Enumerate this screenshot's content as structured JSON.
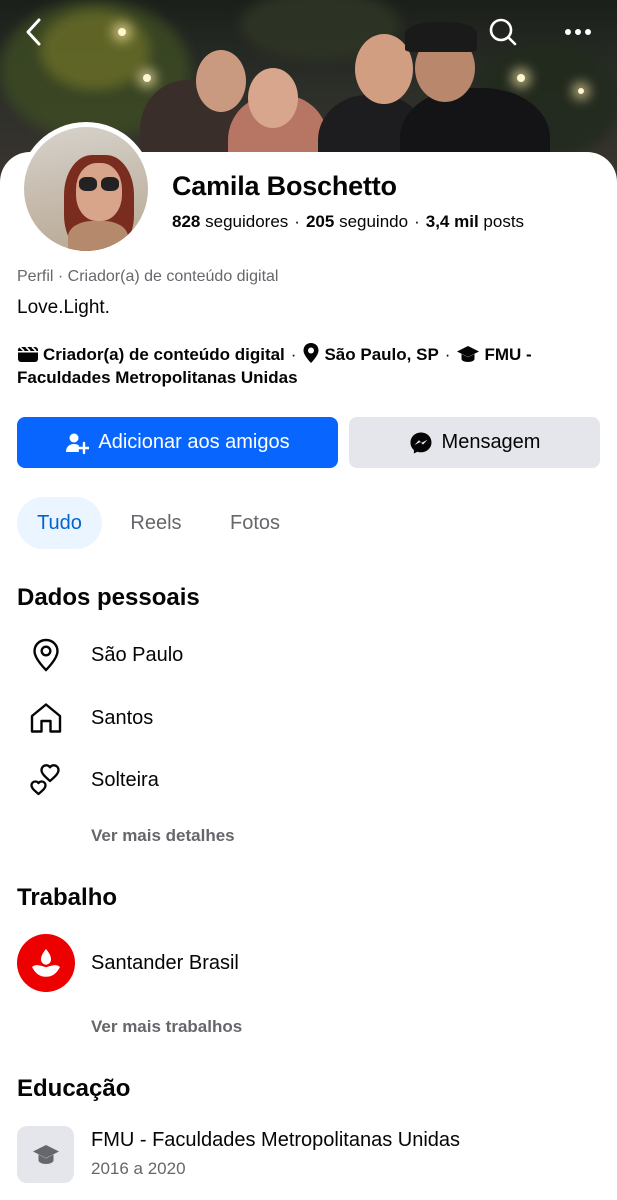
{
  "profile": {
    "name": "Camila Boschetto",
    "followers_count": "828",
    "followers_label": "seguidores",
    "following_count": "205",
    "following_label": "seguindo",
    "posts_count": "3,4 mil",
    "posts_label": "posts",
    "subtitle": "Perfil · Criador(a) de conteúdo digital",
    "bio": "Love.Light."
  },
  "intro": {
    "category": "Criador(a) de conteúdo digital",
    "location": "São Paulo, SP",
    "education": "FMU - Faculdades Metropolitanas Unidas",
    "separator": "·"
  },
  "actions": {
    "add_friend": "Adicionar aos amigos",
    "message": "Mensagem"
  },
  "tabs": [
    {
      "label": "Tudo",
      "active": true
    },
    {
      "label": "Reels",
      "active": false
    },
    {
      "label": "Fotos",
      "active": false
    }
  ],
  "personal": {
    "title": "Dados pessoais",
    "items": [
      {
        "icon": "location-pin-icon",
        "text": "São Paulo"
      },
      {
        "icon": "home-icon",
        "text": "Santos"
      },
      {
        "icon": "hearts-icon",
        "text": "Solteira"
      }
    ],
    "more": "Ver mais detalhes"
  },
  "work": {
    "title": "Trabalho",
    "employer": "Santander Brasil",
    "more": "Ver mais trabalhos"
  },
  "education": {
    "title": "Educação",
    "school": "FMU - Faculdades Metropolitanas Unidas",
    "years": "2016 a 2020"
  },
  "colors": {
    "primary": "#0866ff",
    "tab_active_bg": "#ebf5ff",
    "tab_active_text": "#0064d1",
    "secondary_text": "#65676b",
    "santander_red": "#ec0000"
  }
}
